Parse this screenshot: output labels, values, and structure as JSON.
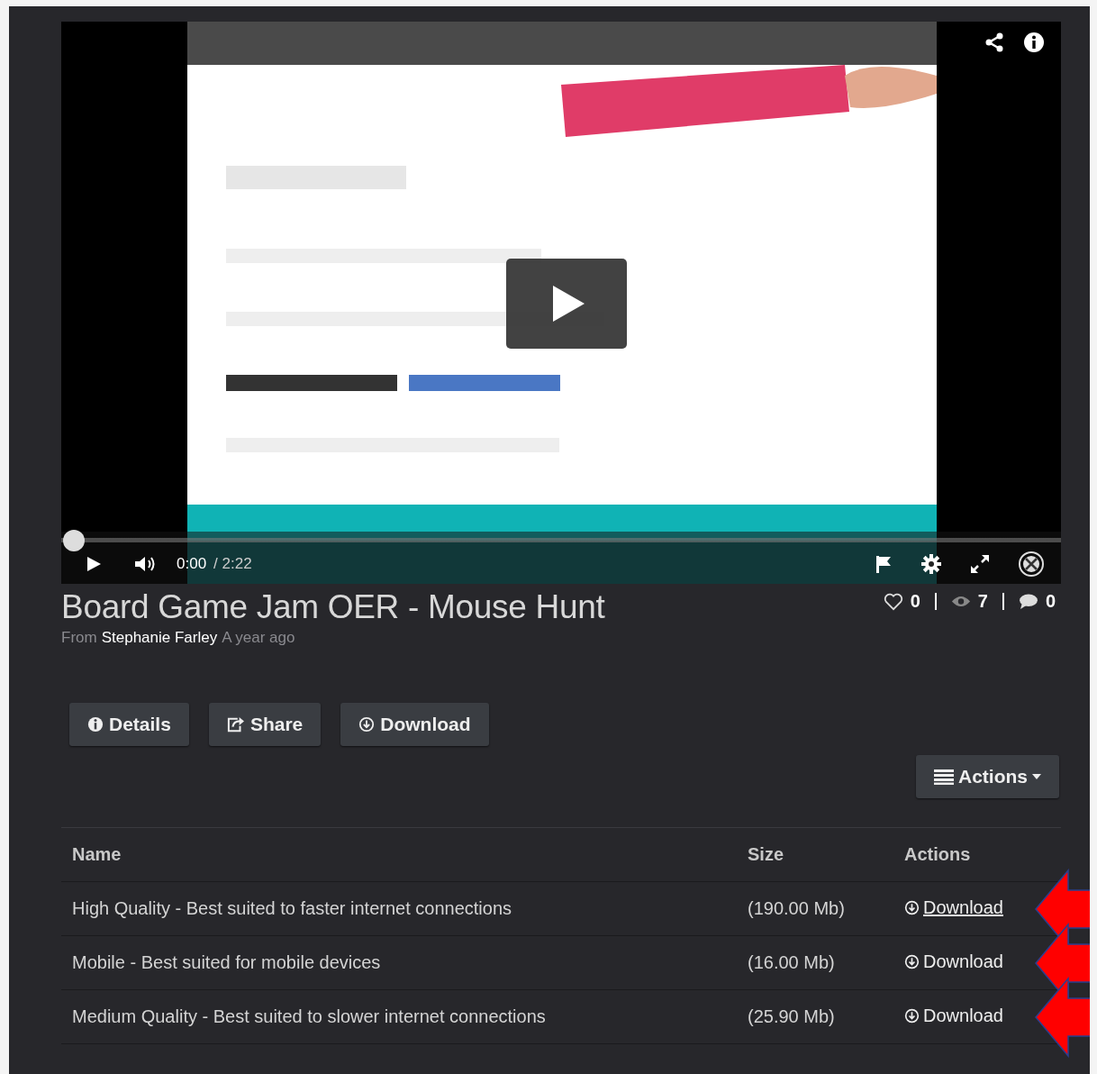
{
  "video": {
    "kind": "picture",
    "level": 0,
    "elapsed": "0:00",
    "duration": "/ 2:22"
  },
  "title": "Board Game Jam OER - Mouse Hunt",
  "byline": {
    "prefix": "From",
    "author": "Stephanie Farley",
    "age": "A year ago"
  },
  "stats": [
    {
      "kind": "likes",
      "value": "0"
    },
    {
      "kind": "views",
      "value": "7"
    },
    {
      "kind": "comments",
      "value": "0"
    }
  ],
  "tabs": [
    {
      "kind": "info",
      "label": "Details"
    },
    {
      "kind": "share",
      "label": "Share"
    },
    {
      "kind": "download",
      "label": "Download"
    }
  ],
  "actions_button": "Actions",
  "table": {
    "columns": [
      "Name",
      "Size",
      "Actions"
    ],
    "rows": [
      {
        "name": "High Quality - Best suited to faster internet connections",
        "size": "(190.00 Mb)",
        "action": "Download",
        "hovered": true,
        "arrow": true
      },
      {
        "name": "Mobile - Best suited for mobile devices",
        "size": "(16.00 Mb)",
        "action": "Download",
        "hovered": false,
        "arrow": true
      },
      {
        "name": "Medium Quality - Best suited to slower internet connections",
        "size": "(25.90 Mb)",
        "action": "Download",
        "hovered": false,
        "arrow": true
      }
    ]
  }
}
